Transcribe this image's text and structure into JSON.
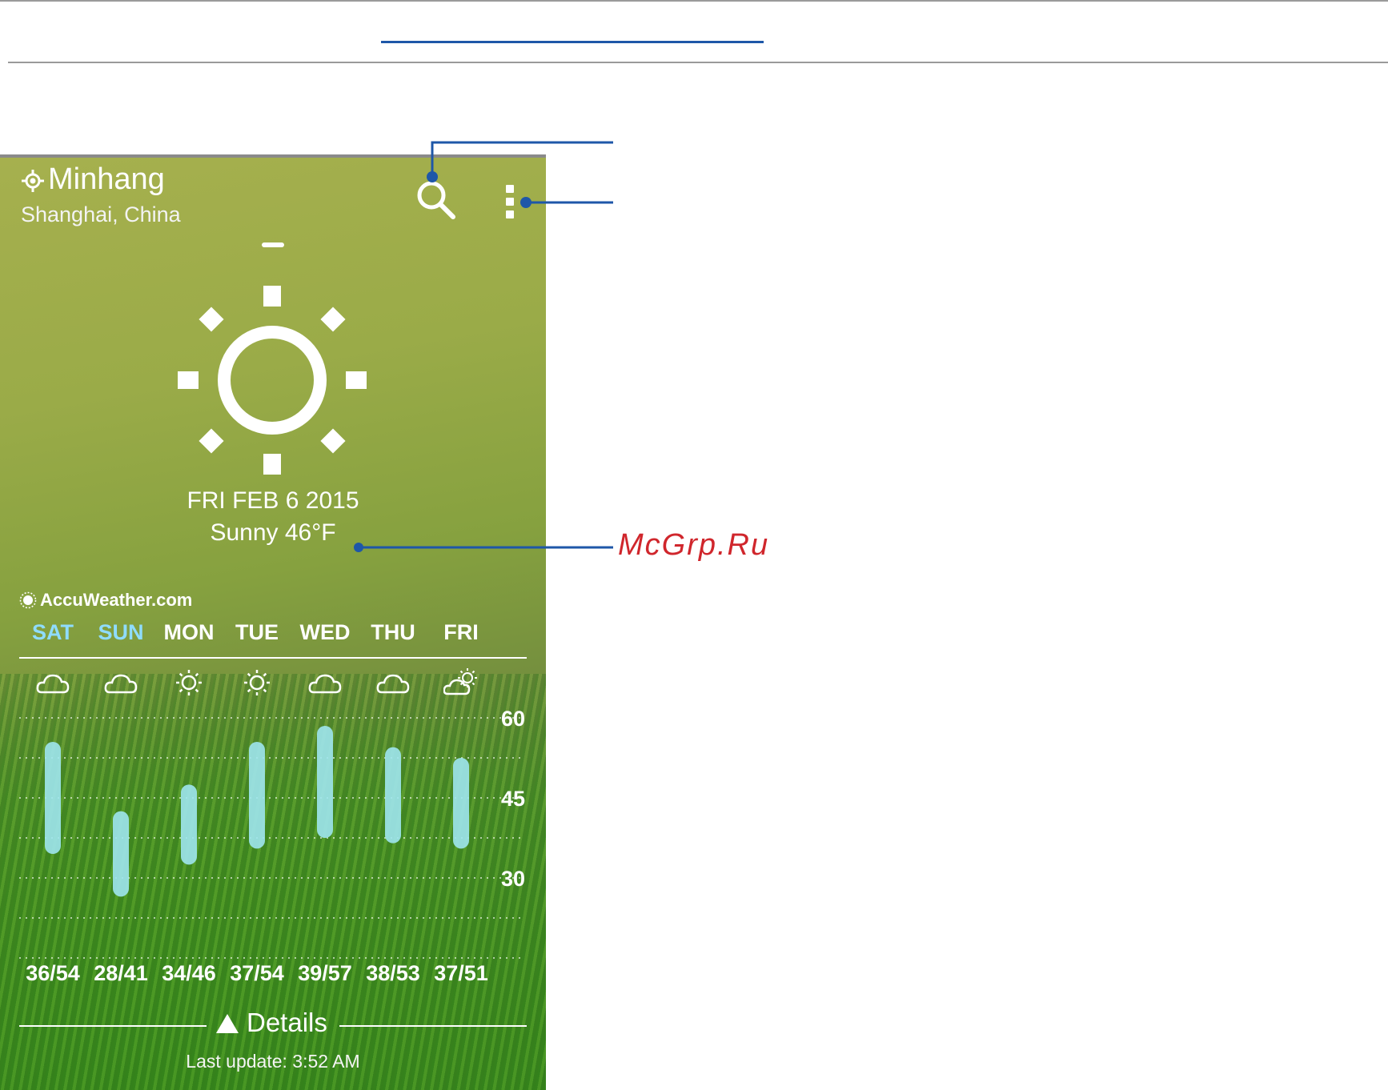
{
  "location": {
    "city": "Minhang",
    "region": "Shanghai, China"
  },
  "today": {
    "date": "FRI FEB 6 2015",
    "condition": "Sunny 46°F",
    "icon": "sun-icon"
  },
  "provider": "AccuWeather.com",
  "forecast": {
    "days": [
      {
        "label": "SAT",
        "icon": "cloud-icon",
        "low": 36,
        "high": 54,
        "range": "36/54",
        "weekend": true
      },
      {
        "label": "SUN",
        "icon": "cloud-icon",
        "low": 28,
        "high": 41,
        "range": "28/41",
        "weekend": true
      },
      {
        "label": "MON",
        "icon": "sun-icon",
        "low": 34,
        "high": 46,
        "range": "34/46",
        "weekend": false
      },
      {
        "label": "TUE",
        "icon": "sun-icon",
        "low": 37,
        "high": 54,
        "range": "37/54",
        "weekend": false
      },
      {
        "label": "WED",
        "icon": "cloud-icon",
        "low": 39,
        "high": 57,
        "range": "39/57",
        "weekend": false
      },
      {
        "label": "THU",
        "icon": "cloud-icon",
        "low": 38,
        "high": 53,
        "range": "38/53",
        "weekend": false
      },
      {
        "label": "FRI",
        "icon": "partly-cloudy-icon",
        "low": 37,
        "high": 51,
        "range": "37/51",
        "weekend": false
      }
    ],
    "y_ticks": [
      60,
      45,
      30
    ],
    "y_ticks_labels": [
      "60",
      "45",
      "30"
    ],
    "y_range": [
      15,
      60
    ]
  },
  "details": {
    "label": "Details",
    "last_update": "Last update: 3:52 AM"
  },
  "watermark": "McGrp.Ru",
  "colors": {
    "bar": "#9fe6ee",
    "weekend": "#8fdcff",
    "callout": "#1e57a8",
    "watermark": "#d0262c"
  }
}
